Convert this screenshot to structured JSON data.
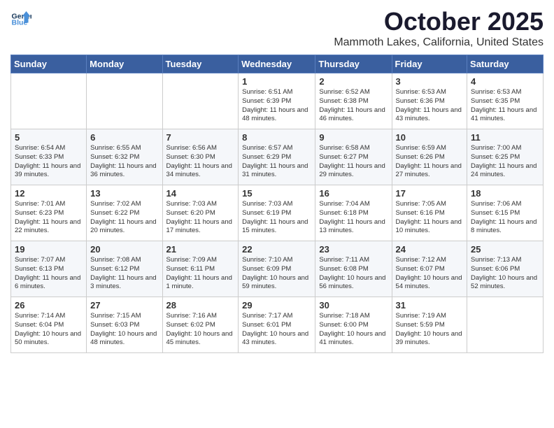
{
  "header": {
    "logo_general": "General",
    "logo_blue": "Blue",
    "month_year": "October 2025",
    "location": "Mammoth Lakes, California, United States"
  },
  "weekdays": [
    "Sunday",
    "Monday",
    "Tuesday",
    "Wednesday",
    "Thursday",
    "Friday",
    "Saturday"
  ],
  "weeks": [
    [
      {
        "day": "",
        "sunrise": "",
        "sunset": "",
        "daylight": ""
      },
      {
        "day": "",
        "sunrise": "",
        "sunset": "",
        "daylight": ""
      },
      {
        "day": "",
        "sunrise": "",
        "sunset": "",
        "daylight": ""
      },
      {
        "day": "1",
        "sunrise": "Sunrise: 6:51 AM",
        "sunset": "Sunset: 6:39 PM",
        "daylight": "Daylight: 11 hours and 48 minutes."
      },
      {
        "day": "2",
        "sunrise": "Sunrise: 6:52 AM",
        "sunset": "Sunset: 6:38 PM",
        "daylight": "Daylight: 11 hours and 46 minutes."
      },
      {
        "day": "3",
        "sunrise": "Sunrise: 6:53 AM",
        "sunset": "Sunset: 6:36 PM",
        "daylight": "Daylight: 11 hours and 43 minutes."
      },
      {
        "day": "4",
        "sunrise": "Sunrise: 6:53 AM",
        "sunset": "Sunset: 6:35 PM",
        "daylight": "Daylight: 11 hours and 41 minutes."
      }
    ],
    [
      {
        "day": "5",
        "sunrise": "Sunrise: 6:54 AM",
        "sunset": "Sunset: 6:33 PM",
        "daylight": "Daylight: 11 hours and 39 minutes."
      },
      {
        "day": "6",
        "sunrise": "Sunrise: 6:55 AM",
        "sunset": "Sunset: 6:32 PM",
        "daylight": "Daylight: 11 hours and 36 minutes."
      },
      {
        "day": "7",
        "sunrise": "Sunrise: 6:56 AM",
        "sunset": "Sunset: 6:30 PM",
        "daylight": "Daylight: 11 hours and 34 minutes."
      },
      {
        "day": "8",
        "sunrise": "Sunrise: 6:57 AM",
        "sunset": "Sunset: 6:29 PM",
        "daylight": "Daylight: 11 hours and 31 minutes."
      },
      {
        "day": "9",
        "sunrise": "Sunrise: 6:58 AM",
        "sunset": "Sunset: 6:27 PM",
        "daylight": "Daylight: 11 hours and 29 minutes."
      },
      {
        "day": "10",
        "sunrise": "Sunrise: 6:59 AM",
        "sunset": "Sunset: 6:26 PM",
        "daylight": "Daylight: 11 hours and 27 minutes."
      },
      {
        "day": "11",
        "sunrise": "Sunrise: 7:00 AM",
        "sunset": "Sunset: 6:25 PM",
        "daylight": "Daylight: 11 hours and 24 minutes."
      }
    ],
    [
      {
        "day": "12",
        "sunrise": "Sunrise: 7:01 AM",
        "sunset": "Sunset: 6:23 PM",
        "daylight": "Daylight: 11 hours and 22 minutes."
      },
      {
        "day": "13",
        "sunrise": "Sunrise: 7:02 AM",
        "sunset": "Sunset: 6:22 PM",
        "daylight": "Daylight: 11 hours and 20 minutes."
      },
      {
        "day": "14",
        "sunrise": "Sunrise: 7:03 AM",
        "sunset": "Sunset: 6:20 PM",
        "daylight": "Daylight: 11 hours and 17 minutes."
      },
      {
        "day": "15",
        "sunrise": "Sunrise: 7:03 AM",
        "sunset": "Sunset: 6:19 PM",
        "daylight": "Daylight: 11 hours and 15 minutes."
      },
      {
        "day": "16",
        "sunrise": "Sunrise: 7:04 AM",
        "sunset": "Sunset: 6:18 PM",
        "daylight": "Daylight: 11 hours and 13 minutes."
      },
      {
        "day": "17",
        "sunrise": "Sunrise: 7:05 AM",
        "sunset": "Sunset: 6:16 PM",
        "daylight": "Daylight: 11 hours and 10 minutes."
      },
      {
        "day": "18",
        "sunrise": "Sunrise: 7:06 AM",
        "sunset": "Sunset: 6:15 PM",
        "daylight": "Daylight: 11 hours and 8 minutes."
      }
    ],
    [
      {
        "day": "19",
        "sunrise": "Sunrise: 7:07 AM",
        "sunset": "Sunset: 6:13 PM",
        "daylight": "Daylight: 11 hours and 6 minutes."
      },
      {
        "day": "20",
        "sunrise": "Sunrise: 7:08 AM",
        "sunset": "Sunset: 6:12 PM",
        "daylight": "Daylight: 11 hours and 3 minutes."
      },
      {
        "day": "21",
        "sunrise": "Sunrise: 7:09 AM",
        "sunset": "Sunset: 6:11 PM",
        "daylight": "Daylight: 11 hours and 1 minute."
      },
      {
        "day": "22",
        "sunrise": "Sunrise: 7:10 AM",
        "sunset": "Sunset: 6:09 PM",
        "daylight": "Daylight: 10 hours and 59 minutes."
      },
      {
        "day": "23",
        "sunrise": "Sunrise: 7:11 AM",
        "sunset": "Sunset: 6:08 PM",
        "daylight": "Daylight: 10 hours and 56 minutes."
      },
      {
        "day": "24",
        "sunrise": "Sunrise: 7:12 AM",
        "sunset": "Sunset: 6:07 PM",
        "daylight": "Daylight: 10 hours and 54 minutes."
      },
      {
        "day": "25",
        "sunrise": "Sunrise: 7:13 AM",
        "sunset": "Sunset: 6:06 PM",
        "daylight": "Daylight: 10 hours and 52 minutes."
      }
    ],
    [
      {
        "day": "26",
        "sunrise": "Sunrise: 7:14 AM",
        "sunset": "Sunset: 6:04 PM",
        "daylight": "Daylight: 10 hours and 50 minutes."
      },
      {
        "day": "27",
        "sunrise": "Sunrise: 7:15 AM",
        "sunset": "Sunset: 6:03 PM",
        "daylight": "Daylight: 10 hours and 48 minutes."
      },
      {
        "day": "28",
        "sunrise": "Sunrise: 7:16 AM",
        "sunset": "Sunset: 6:02 PM",
        "daylight": "Daylight: 10 hours and 45 minutes."
      },
      {
        "day": "29",
        "sunrise": "Sunrise: 7:17 AM",
        "sunset": "Sunset: 6:01 PM",
        "daylight": "Daylight: 10 hours and 43 minutes."
      },
      {
        "day": "30",
        "sunrise": "Sunrise: 7:18 AM",
        "sunset": "Sunset: 6:00 PM",
        "daylight": "Daylight: 10 hours and 41 minutes."
      },
      {
        "day": "31",
        "sunrise": "Sunrise: 7:19 AM",
        "sunset": "Sunset: 5:59 PM",
        "daylight": "Daylight: 10 hours and 39 minutes."
      },
      {
        "day": "",
        "sunrise": "",
        "sunset": "",
        "daylight": ""
      }
    ]
  ]
}
